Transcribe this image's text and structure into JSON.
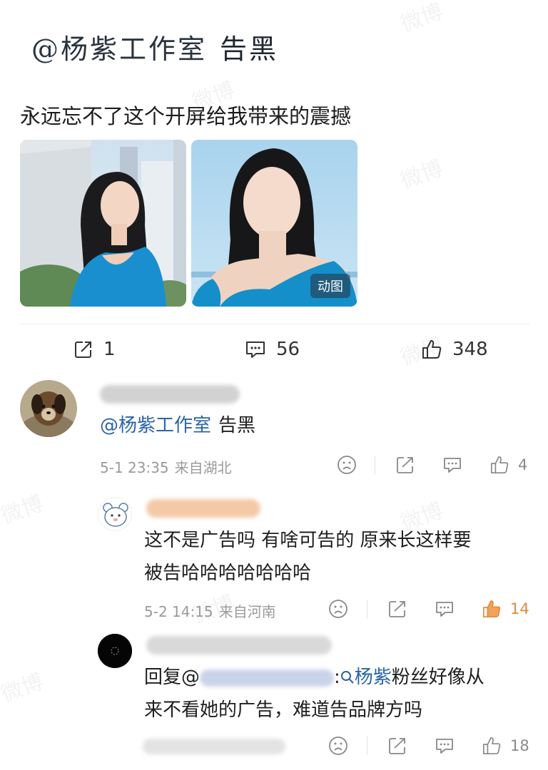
{
  "overlay": {
    "mention": "@杨紫工作室",
    "action": "告黑"
  },
  "post": {
    "text": "永远忘不了这个开屏给我带来的震撼",
    "images": [
      {
        "name": "woman-city-photo"
      },
      {
        "name": "woman-sky-photo",
        "badge": "动图"
      }
    ],
    "actions": {
      "repost_count": "1",
      "comment_count": "56",
      "like_count": "348"
    }
  },
  "comments": [
    {
      "id": "c1",
      "mention": "@杨紫工作室",
      "text": "告黑",
      "time": "5-1 23:35",
      "location": "来自湖北",
      "like_count": "4"
    },
    {
      "id": "c2",
      "line1": "这不是广告吗 有啥可告的 原来长这样要",
      "line2": "被告哈哈哈哈哈哈哈",
      "time": "5-2 14:15",
      "location": "来自河南",
      "like_count": "14",
      "liked": true
    },
    {
      "id": "c3",
      "reply_prefix": "回复@",
      "reply_colon": ":",
      "mention": "杨紫",
      "line1_rest": "粉丝好像从",
      "line2": "来不看她的广告，难道告品牌方吗",
      "like_count": "18"
    }
  ],
  "watermark": "微博",
  "colors": {
    "accent_link": "#2a65a8",
    "like_active": "#e08a3c",
    "meta_gray": "#9a9a9a"
  }
}
